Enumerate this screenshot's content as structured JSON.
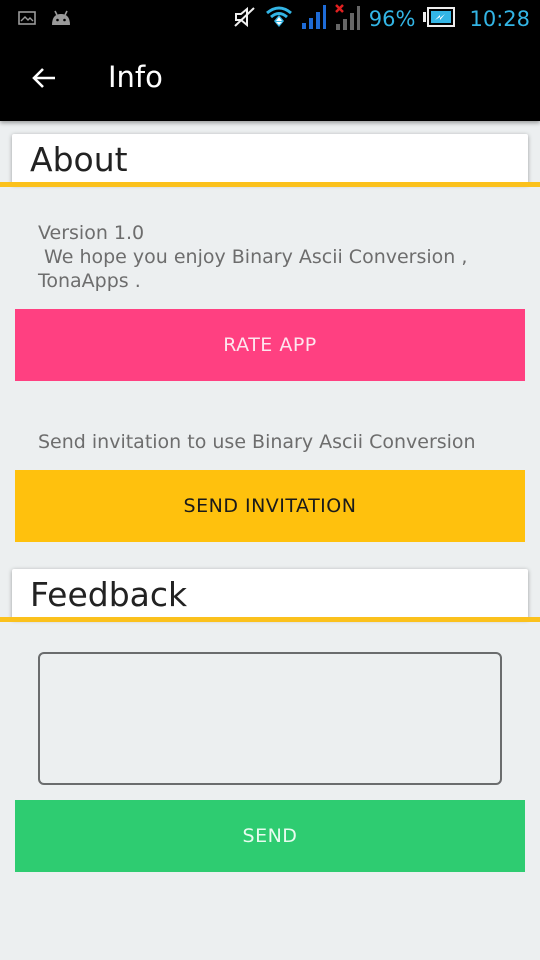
{
  "status_bar": {
    "left_icons": [
      "gallery-notification-icon",
      "android-notification-icon"
    ],
    "right_icons": [
      "mute-icon",
      "wifi-icon",
      "signal-sim1-icon",
      "signal-sim2-no-service-icon"
    ],
    "battery_percent": "96%",
    "time": "10:28",
    "accent_color": "#33b5e5"
  },
  "action_bar": {
    "back_icon": "arrow-back-icon",
    "title": "Info"
  },
  "about": {
    "header": "About",
    "version_text": "Version 1.0\n We hope you enjoy Binary Ascii Conversion ,\nTonaApps .",
    "rate_button": "RATE APP",
    "invite_text": "Send invitation to use Binary Ascii Conversion",
    "invite_button": "SEND INVITATION"
  },
  "feedback": {
    "header": "Feedback",
    "input_value": "",
    "send_button": "SEND"
  },
  "colors": {
    "section_underline": "#fbc11c",
    "rate_button": "#ff4081",
    "invite_button": "#ffc10d",
    "send_button": "#2ecc71",
    "background": "#eceff0"
  }
}
